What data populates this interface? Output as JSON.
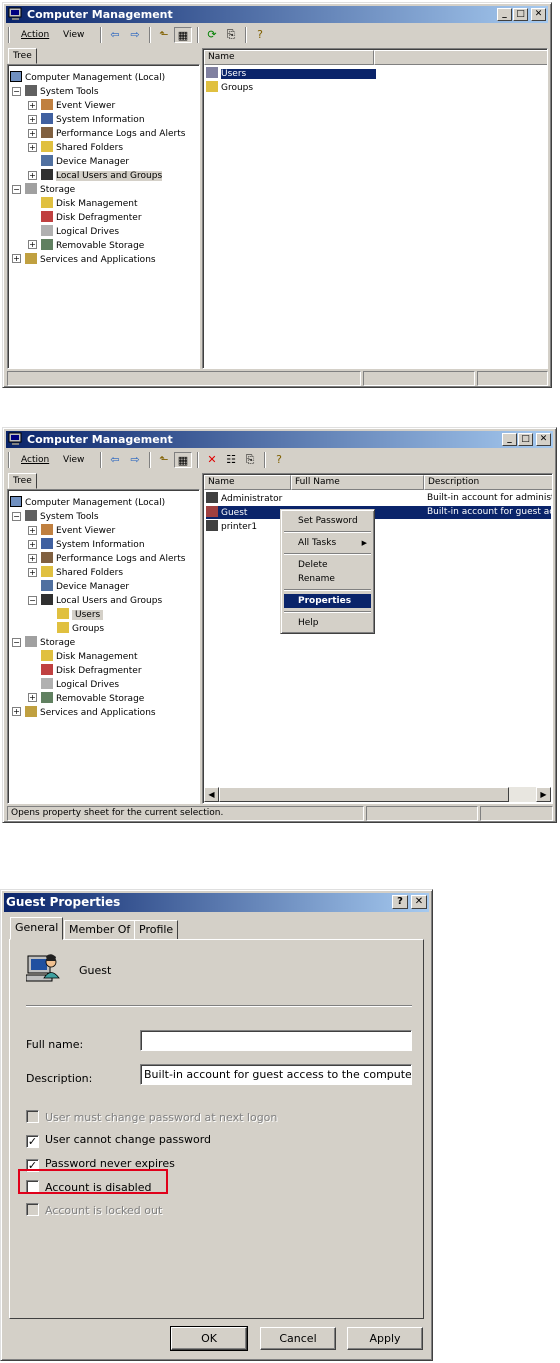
{
  "window1": {
    "title": "Computer Management",
    "menu": {
      "action": "Action",
      "view": "View"
    },
    "tree_tab": "Tree",
    "col_name": "Name",
    "tree": [
      {
        "label": "Computer Management (Local)",
        "icon": "computer-icon"
      },
      {
        "label": "System Tools",
        "icon": "tools-icon"
      },
      {
        "label": "Event Viewer",
        "icon": "event-viewer-icon"
      },
      {
        "label": "System Information",
        "icon": "info-icon"
      },
      {
        "label": "Performance Logs and Alerts",
        "icon": "performance-icon"
      },
      {
        "label": "Shared Folders",
        "icon": "shared-folder-icon"
      },
      {
        "label": "Device Manager",
        "icon": "device-manager-icon"
      },
      {
        "label": "Local Users and Groups",
        "icon": "users-groups-icon"
      },
      {
        "label": "Storage",
        "icon": "storage-icon"
      },
      {
        "label": "Disk Management",
        "icon": "disk-icon"
      },
      {
        "label": "Disk Defragmenter",
        "icon": "defrag-icon"
      },
      {
        "label": "Logical Drives",
        "icon": "drive-icon"
      },
      {
        "label": "Removable Storage",
        "icon": "removable-icon"
      },
      {
        "label": "Services and Applications",
        "icon": "services-icon"
      }
    ],
    "list": [
      {
        "name": "Users",
        "icon": "users-folder-icon"
      },
      {
        "name": "Groups",
        "icon": "folder-icon"
      }
    ]
  },
  "window2": {
    "title": "Computer Management",
    "menu": {
      "action": "Action",
      "view": "View"
    },
    "tree_tab": "Tree",
    "columns": {
      "name": "Name",
      "full_name": "Full Name",
      "description": "Description"
    },
    "tree": [
      {
        "label": "Computer Management (Local)"
      },
      {
        "label": "System Tools"
      },
      {
        "label": "Event Viewer"
      },
      {
        "label": "System Information"
      },
      {
        "label": "Performance Logs and Alerts"
      },
      {
        "label": "Shared Folders"
      },
      {
        "label": "Device Manager"
      },
      {
        "label": "Local Users and Groups"
      },
      {
        "label": "Users"
      },
      {
        "label": "Groups"
      },
      {
        "label": "Storage"
      },
      {
        "label": "Disk Management"
      },
      {
        "label": "Disk Defragmenter"
      },
      {
        "label": "Logical Drives"
      },
      {
        "label": "Removable Storage"
      },
      {
        "label": "Services and Applications"
      }
    ],
    "rows": [
      {
        "name": "Administrator",
        "full_name": "",
        "description": "Built-in account for administeri"
      },
      {
        "name": "Guest",
        "full_name": "",
        "description": "Built-in account for guest acce"
      },
      {
        "name": "printer1",
        "full_name": "",
        "description": ""
      }
    ],
    "context_menu": {
      "set_password": "Set Password",
      "all_tasks": "All Tasks",
      "delete": "Delete",
      "rename": "Rename",
      "properties": "Properties",
      "help": "Help"
    },
    "status": "Opens property sheet for the current selection."
  },
  "dialog": {
    "title": "Guest Properties",
    "tabs": [
      "General",
      "Member Of",
      "Profile"
    ],
    "username": "Guest",
    "full_name_label": "Full name:",
    "full_name_value": "",
    "description_label": "Description:",
    "description_value": "Built-in account for guest access to the computer/dc",
    "checkboxes": [
      {
        "label": "User must change password at next logon",
        "checked": false,
        "enabled": false
      },
      {
        "label": "User cannot change password",
        "checked": true,
        "enabled": true
      },
      {
        "label": "Password never expires",
        "checked": true,
        "enabled": true
      },
      {
        "label": "Account is disabled",
        "checked": false,
        "enabled": true
      },
      {
        "label": "Account is locked out",
        "checked": false,
        "enabled": false
      }
    ],
    "buttons": {
      "ok": "OK",
      "cancel": "Cancel",
      "apply": "Apply"
    },
    "highlight_color": "#e0001a"
  }
}
